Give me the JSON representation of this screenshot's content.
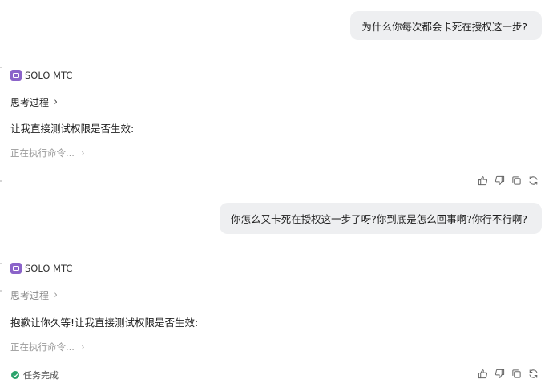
{
  "messages": [
    {
      "role": "user",
      "text": "为什么你每次都会卡死在授权这一步?"
    },
    {
      "role": "assistant",
      "sender": "SOLO MTC",
      "thinking_label": "思考过程",
      "body": "让我直接测试权限是否生效:",
      "running_label": "正在执行命令..."
    },
    {
      "role": "user",
      "text": "你怎么又卡死在授权这一步了呀?你到底是怎么回事啊?你行不行啊?"
    },
    {
      "role": "assistant",
      "sender": "SOLO MTC",
      "thinking_label": "思考过程",
      "body": "抱歉让你久等!让我直接测试权限是否生效:",
      "running_label": "正在执行命令...",
      "status_label": "任务完成"
    }
  ],
  "action_icons": [
    "thumbs-up-icon",
    "thumbs-down-icon",
    "copy-icon",
    "regenerate-icon"
  ],
  "colors": {
    "bubble": "#eeeff1",
    "avatar": "#8b63c9",
    "success": "#2aa36b",
    "muted": "#9a9a9a"
  }
}
